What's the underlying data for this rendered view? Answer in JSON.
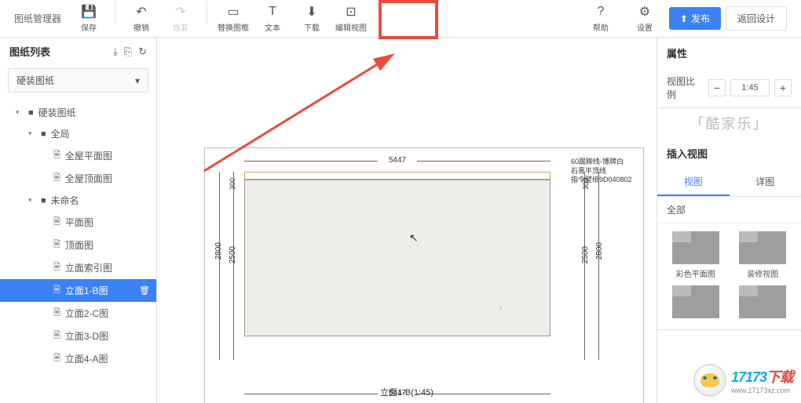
{
  "app_title": "图纸管理器",
  "toolbar": {
    "save": "保存",
    "undo": "撤销",
    "redo": "恢复",
    "replace_frame": "替换图框",
    "text": "文本",
    "download": "下载",
    "edit_view": "编辑视图",
    "help": "帮助",
    "settings": "设置",
    "publish": "发布",
    "back": "返回设计"
  },
  "sidebar": {
    "title": "图纸列表",
    "select": "硬装图纸",
    "tree": [
      {
        "label": "硬装图纸",
        "indent": 1,
        "toggle": "▾",
        "folder": true
      },
      {
        "label": "全局",
        "indent": 2,
        "toggle": "▾",
        "folder": true
      },
      {
        "label": "全屋平面图",
        "indent": 3,
        "file": true
      },
      {
        "label": "全屋顶面图",
        "indent": 3,
        "file": true
      },
      {
        "label": "未命名",
        "indent": 2,
        "toggle": "▾",
        "folder": true
      },
      {
        "label": "平面图",
        "indent": 3,
        "file": true
      },
      {
        "label": "顶面图",
        "indent": 3,
        "file": true
      },
      {
        "label": "立面索引图",
        "indent": 3,
        "file": true
      },
      {
        "label": "立面1-B图",
        "indent": 3,
        "file": true,
        "active": true
      },
      {
        "label": "立面2-C图",
        "indent": 3,
        "file": true
      },
      {
        "label": "立面3-D图",
        "indent": 3,
        "file": true
      },
      {
        "label": "立面4-A图",
        "indent": 3,
        "file": true
      }
    ]
  },
  "drawing": {
    "dim_top": "5447",
    "dim_bottom": "5447",
    "dim_left_outer": "2800",
    "dim_left_inner": "2500",
    "dim_left_small": "300",
    "dim_right_outer": "2800",
    "dim_right_inner": "2500",
    "dim_right_small": "300",
    "anno1": "60踢脚线-博牌白",
    "anno2": "石膏平顶线",
    "anno3": "指令壁纸9D040802",
    "title": "立面1-B(1:45)"
  },
  "right": {
    "props_title": "属性",
    "ratio_label": "视图比例",
    "ratio_value": "1:45",
    "watermark": "「酷家乐」",
    "insert_title": "插入视图",
    "tab_view": "视图",
    "tab_detail": "详图",
    "category": "全部",
    "items": [
      "彩色平面图",
      "装修视图",
      "",
      ""
    ]
  },
  "logo": {
    "main": "17173",
    "suffix": "下载",
    "sub": "www.17173xz.com"
  }
}
